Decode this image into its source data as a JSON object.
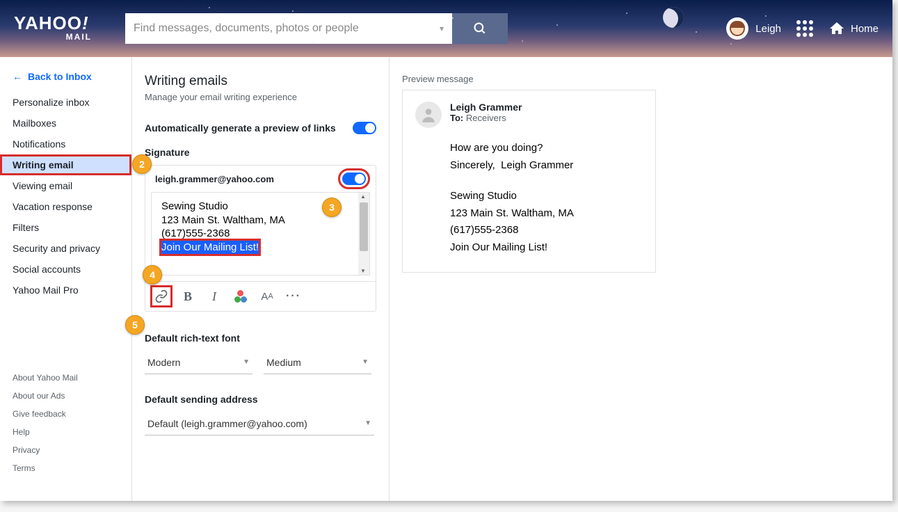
{
  "brand": {
    "name": "YAHOO",
    "exclaim": "!",
    "sub": "MAIL"
  },
  "search": {
    "placeholder": "Find messages, documents, photos or people"
  },
  "user": {
    "name": "Leigh"
  },
  "home_label": "Home",
  "back_link": "Back to Inbox",
  "sidebar": {
    "items": [
      {
        "label": "Personalize inbox"
      },
      {
        "label": "Mailboxes"
      },
      {
        "label": "Notifications"
      },
      {
        "label": "Writing email"
      },
      {
        "label": "Viewing email"
      },
      {
        "label": "Vacation response"
      },
      {
        "label": "Filters"
      },
      {
        "label": "Security and privacy"
      },
      {
        "label": "Social accounts"
      },
      {
        "label": "Yahoo Mail Pro"
      }
    ]
  },
  "footer": {
    "items": [
      {
        "label": "About Yahoo Mail"
      },
      {
        "label": "About our Ads"
      },
      {
        "label": "Give feedback"
      },
      {
        "label": "Help"
      },
      {
        "label": "Privacy"
      },
      {
        "label": "Terms"
      }
    ]
  },
  "settings": {
    "title": "Writing emails",
    "subtitle": "Manage your email writing experience",
    "auto_preview_label": "Automatically generate a preview of links",
    "signature_label": "Signature",
    "signature_email": "leigh.grammer@yahoo.com",
    "sig_lines": {
      "l1": "Sewing Studio",
      "l2": "123 Main St. Waltham, MA",
      "l3": "(617)555-2368",
      "l4": "Join Our Mailing List!"
    },
    "font_section": "Default rich-text font",
    "font_family": "Modern",
    "font_size": "Medium",
    "sender_section": "Default sending address",
    "sender_value": "Default (leigh.grammer@yahoo.com)"
  },
  "preview": {
    "label": "Preview message",
    "from": "Leigh Grammer",
    "to_label": "To:",
    "to_value": "Receivers",
    "line1": "How are you doing?",
    "line2a": "Sincerely,",
    "line2b": "Leigh Grammer",
    "sig": {
      "l1": "Sewing Studio",
      "l2": "123 Main St. Waltham, MA",
      "l3": "(617)555-2368",
      "l4": "Join Our Mailing List!"
    }
  },
  "callouts": {
    "c2": "2",
    "c3": "3",
    "c4": "4",
    "c5": "5"
  }
}
